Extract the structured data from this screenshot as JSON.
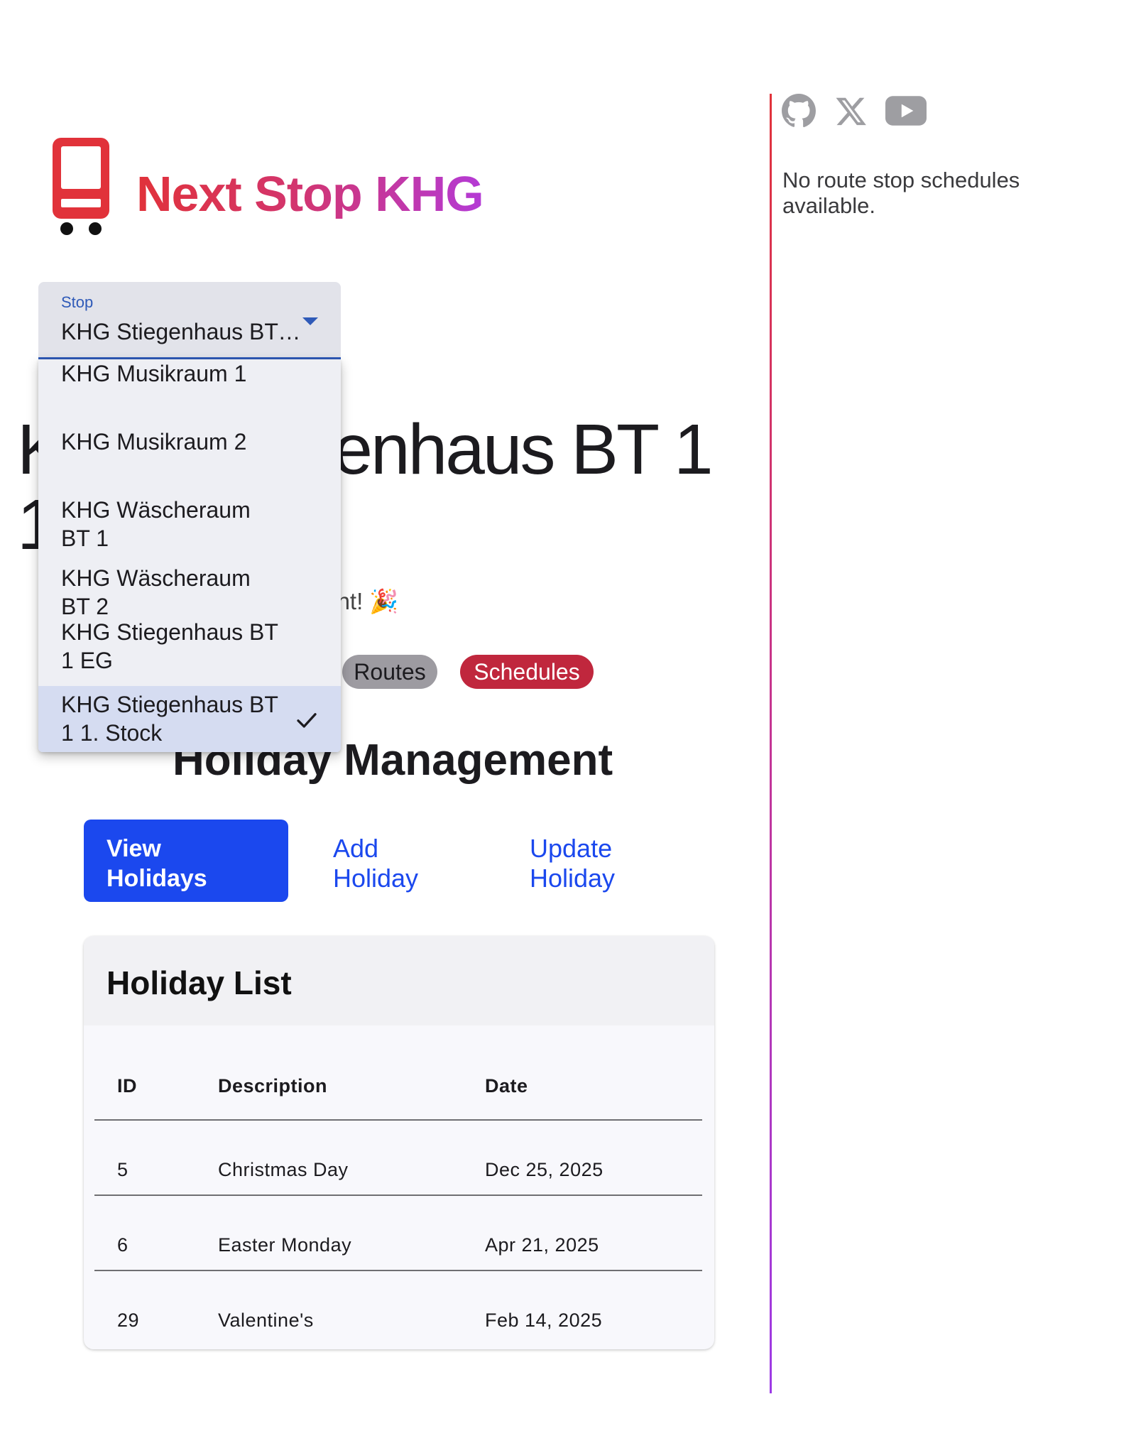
{
  "app": {
    "title": "Next Stop KHG",
    "brand_gradient": [
      "#e1323a",
      "#d3356d",
      "#b43ad6"
    ]
  },
  "stop_select": {
    "label": "Stop",
    "value": "KHG Stiegenhaus BT 1 1. Stock",
    "accent_color": "#2f5ab8"
  },
  "stop_menu": {
    "items": [
      {
        "label": "KHG Musikraum 1",
        "selected": false
      },
      {
        "label": "KHG Musikraum 2",
        "selected": false
      },
      {
        "label": "KHG Wäscheraum BT 1",
        "selected": false
      },
      {
        "label": "KHG Wäscheraum BT 2",
        "selected": false
      },
      {
        "label": "KHG Stiegenhaus BT 1 EG",
        "selected": false
      },
      {
        "label": "KHG Stiegenhaus BT 1 1. Stock",
        "selected": true
      }
    ]
  },
  "stop_heading": "KHG Stiegenhaus BT 1 1. Stock",
  "event_text": "Next KHG Event! 🎉",
  "nav_chips": {
    "routes": "Routes",
    "schedules": "Schedules"
  },
  "holiday_section": {
    "title": "Holiday Management",
    "buttons": {
      "view": "View Holidays",
      "add": "Add Holiday",
      "update": "Update Holiday"
    }
  },
  "holiday_table": {
    "title": "Holiday List",
    "columns": [
      "ID",
      "Description",
      "Date"
    ],
    "rows": [
      {
        "id": "5",
        "description": "Christmas Day",
        "date": "Dec 25, 2025"
      },
      {
        "id": "6",
        "description": "Easter Monday",
        "date": "Apr 21, 2025"
      },
      {
        "id": "29",
        "description": "Valentine's",
        "date": "Feb 14, 2025"
      }
    ]
  },
  "sidebar": {
    "social_icons": [
      "github-icon",
      "x-icon",
      "youtube-icon"
    ],
    "schedule_message": "No route stop schedules available."
  },
  "colors": {
    "primary_button": "#1b48ee",
    "schedules_chip": "#c0273d",
    "routes_chip": "#9d9ba1",
    "bus_icon": "#e1323a"
  }
}
